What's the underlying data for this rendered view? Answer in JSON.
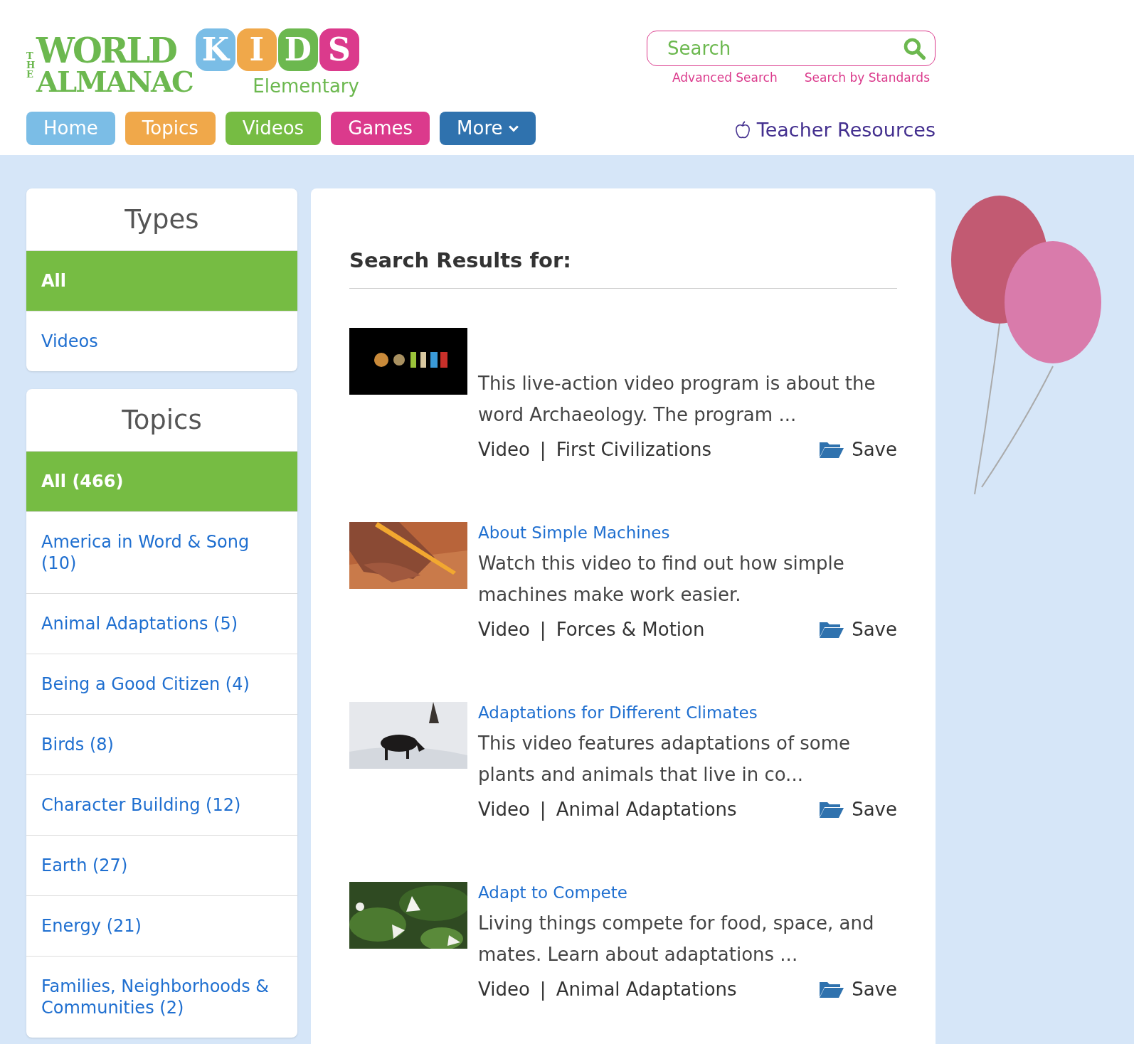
{
  "logo": {
    "the": "THE",
    "line1": "WORLD",
    "line2": "ALMANAC",
    "kids": [
      {
        "letter": "K",
        "color": "#7abde6"
      },
      {
        "letter": "I",
        "color": "#f0a84a"
      },
      {
        "letter": "D",
        "color": "#6cb84f"
      },
      {
        "letter": "S",
        "color": "#db3a8c"
      }
    ],
    "sub": "Elementary"
  },
  "search": {
    "placeholder": "Search"
  },
  "search_links": [
    "Advanced Search",
    "Search by Standards"
  ],
  "nav": [
    {
      "label": "Home",
      "color": "#7bbde6",
      "kind": "link"
    },
    {
      "label": "Topics",
      "color": "#f0a84a",
      "kind": "link"
    },
    {
      "label": "Videos",
      "color": "#76bc43",
      "kind": "link"
    },
    {
      "label": "Games",
      "color": "#db3a8c",
      "kind": "link"
    },
    {
      "label": "More",
      "color": "#2f72ae",
      "kind": "dropdown"
    }
  ],
  "teacher_link": "Teacher Resources",
  "types": {
    "title": "Types",
    "items": [
      {
        "label": "All",
        "selected": true
      },
      {
        "label": "Videos",
        "selected": false
      }
    ]
  },
  "topics": {
    "title": "Topics",
    "items": [
      {
        "label": "All (466)",
        "selected": true
      },
      {
        "label": "America in Word & Song (10)",
        "selected": false
      },
      {
        "label": "Animal Adaptations (5)",
        "selected": false
      },
      {
        "label": "Being a Good Citizen (4)",
        "selected": false
      },
      {
        "label": "Birds (8)",
        "selected": false
      },
      {
        "label": "Character Building (12)",
        "selected": false
      },
      {
        "label": "Earth (27)",
        "selected": false
      },
      {
        "label": "Energy (21)",
        "selected": false
      },
      {
        "label": "Families, Neighborhoods & Communities (2)",
        "selected": false
      }
    ]
  },
  "results": {
    "heading": "Search Results for:",
    "items": [
      {
        "description": "This live-action video program is about the word Archaeology. The program ...",
        "type": "Video",
        "separator": "|",
        "topic": "First Civilizations",
        "save": "Save"
      },
      {
        "title": "About Simple Machines",
        "description": "Watch this video to find out how simple machines make work easier.",
        "type": "Video",
        "separator": "|",
        "topic": "Forces & Motion",
        "save": "Save"
      },
      {
        "title": "Adaptations for Different Climates",
        "description": "This video features adaptations of some plants and animals that live in co...",
        "type": "Video",
        "separator": "|",
        "topic": "Animal Adaptations",
        "save": "Save"
      },
      {
        "title": "Adapt to Compete",
        "description": "Living things compete for food, space, and mates. Learn about adaptations ...",
        "type": "Video",
        "separator": "|",
        "topic": "Animal Adaptations",
        "save": "Save"
      }
    ]
  }
}
